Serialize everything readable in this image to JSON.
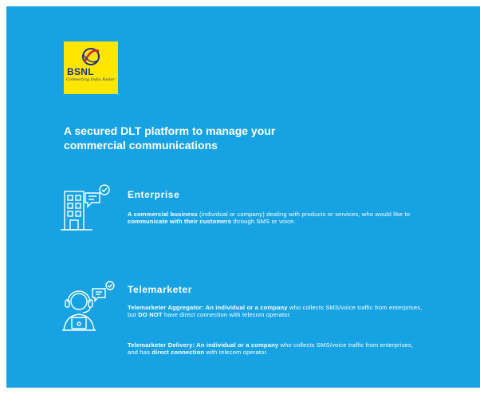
{
  "brand": {
    "logo_text": "BSNL",
    "logo_tagline": "Connecting India Faster",
    "logo_colors": {
      "background": "#ffe600",
      "text": "#1c2f8f",
      "accent": "#d82027"
    }
  },
  "page": {
    "background": "#17a3e3",
    "headline_line1": "A secured DLT platform to manage your",
    "headline_line2": "commercial communications"
  },
  "enterprise": {
    "icon": "office-building-chat-icon",
    "title": "Enterprise",
    "description": {
      "bold_lead": "A commercial business",
      "text_1": " (individual or company) dealing with products or services, who would like to ",
      "bold_mid": "communicate with their customers",
      "text_2": " through SMS or voice."
    }
  },
  "telemarketer": {
    "icon": "headset-agent-chat-icon",
    "title": "Telemarketer",
    "aggregator": {
      "label": "Telemarketer Aggregator: An individual or a company",
      "text_1": " who collects SMS/voice traffic from enterprises, but ",
      "bold": "DO NOT",
      "text_2": " have direct connection with telecom operator."
    },
    "delivery": {
      "label": "Telemarketer Delivery: An individual or a company",
      "text_1": " who collects SMS/voice traffic from enterprises, and has ",
      "bold": "direct connection",
      "text_2": " with telecom operator."
    }
  }
}
